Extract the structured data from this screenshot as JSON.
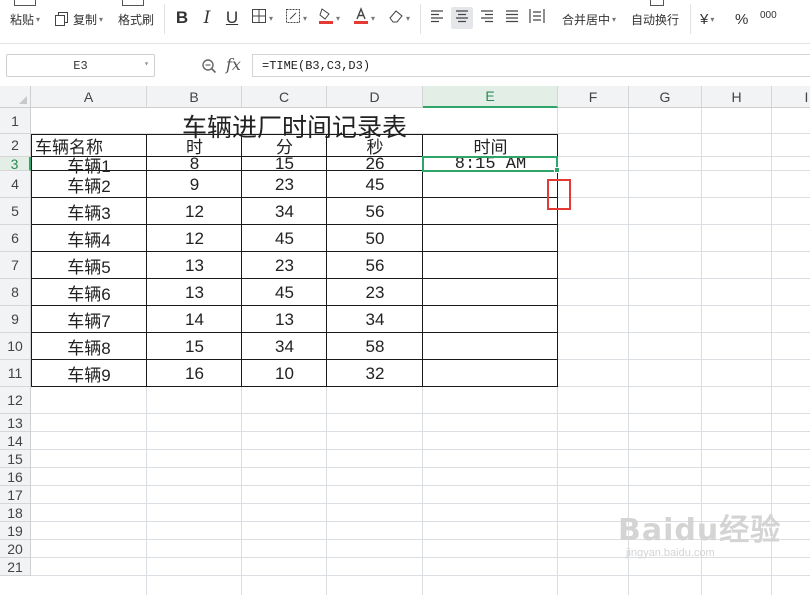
{
  "ribbon": {
    "paste_label": "粘贴",
    "copy_label": "复制",
    "format_painter_label": "格式刷",
    "bold_label": "B",
    "italic_label": "I",
    "underline_label": "U",
    "merge_center_label": "合并居中",
    "wrap_text_label": "自动换行",
    "currency_symbol": "¥",
    "percent_symbol": "%",
    "thousands_symbol": "000",
    "accent_red": "#e53935"
  },
  "formula_bar": {
    "name_box": "E3",
    "fx_label": "fx",
    "formula": "=TIME(B3,C3,D3)"
  },
  "columns": [
    "A",
    "B",
    "C",
    "D",
    "E",
    "F",
    "G",
    "H",
    "I"
  ],
  "rows": [
    "1",
    "2",
    "3",
    "4",
    "5",
    "6",
    "7",
    "8",
    "9",
    "10",
    "11",
    "12",
    "13",
    "14",
    "15",
    "16",
    "17",
    "18",
    "19",
    "20",
    "21"
  ],
  "selected_cell": "E3",
  "sheet": {
    "title": "车辆进厂时间记录表",
    "headers": [
      "车辆名称",
      "时",
      "分",
      "秒",
      "时间"
    ],
    "records": [
      [
        "车辆1",
        "8",
        "15",
        "26",
        "8:15 AM"
      ],
      [
        "车辆2",
        "9",
        "23",
        "45",
        ""
      ],
      [
        "车辆3",
        "12",
        "34",
        "56",
        ""
      ],
      [
        "车辆4",
        "12",
        "45",
        "50",
        ""
      ],
      [
        "车辆5",
        "13",
        "23",
        "56",
        ""
      ],
      [
        "车辆6",
        "13",
        "45",
        "23",
        ""
      ],
      [
        "车辆7",
        "14",
        "13",
        "34",
        ""
      ],
      [
        "车辆8",
        "15",
        "34",
        "58",
        ""
      ],
      [
        "车辆9",
        "16",
        "10",
        "32",
        ""
      ]
    ]
  },
  "watermark": {
    "main": "Baidu经验",
    "sub": "jingyan.baidu.com"
  }
}
